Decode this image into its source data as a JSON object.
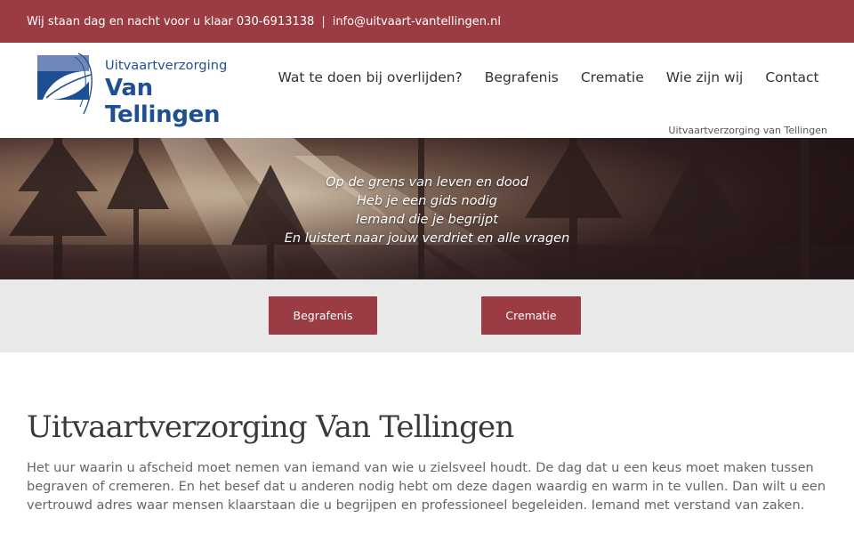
{
  "topbar": {
    "tagline": "Wij staan dag en nacht voor u klaar",
    "phone": "030-6913138",
    "separator": "|",
    "email": "info@uitvaart-vantellingen.nl"
  },
  "logo": {
    "line1": "Uitvaartverzorging",
    "line2": "Van Tellingen"
  },
  "nav": {
    "items": [
      {
        "label": "Wat te doen bij overlijden?"
      },
      {
        "label": "Begrafenis"
      },
      {
        "label": "Crematie"
      },
      {
        "label": "Wie zijn wij"
      },
      {
        "label": "Contact"
      }
    ]
  },
  "breadcrumb": "Uitvaartverzorging van Tellingen",
  "hero": {
    "poem": [
      "Op de grens van leven en dood",
      "Heb je een gids nodig",
      "Iemand die je begrijpt",
      "En luistert naar jouw verdriet en alle vragen"
    ]
  },
  "cta": {
    "button1": "Begrafenis",
    "button2": "Crematie"
  },
  "main": {
    "title": "Uitvaartverzorging Van Tellingen",
    "intro": "Het uur waarin u afscheid moet nemen van iemand van wie u zielsveel houdt. De dag dat u een keus moet maken tussen begraven of cremeren. En het besef dat u anderen nodig hebt om deze dagen waardig en warm in te vullen. Dan wilt u een vertrouwd adres waar mensen klaarstaan die u begrijpen en professioneel begeleiden. Iemand met verstand van zaken."
  },
  "colors": {
    "brand": "#9b3b43",
    "logo_blue": "#1f4f93",
    "cta_band": "#e9e9e9"
  }
}
